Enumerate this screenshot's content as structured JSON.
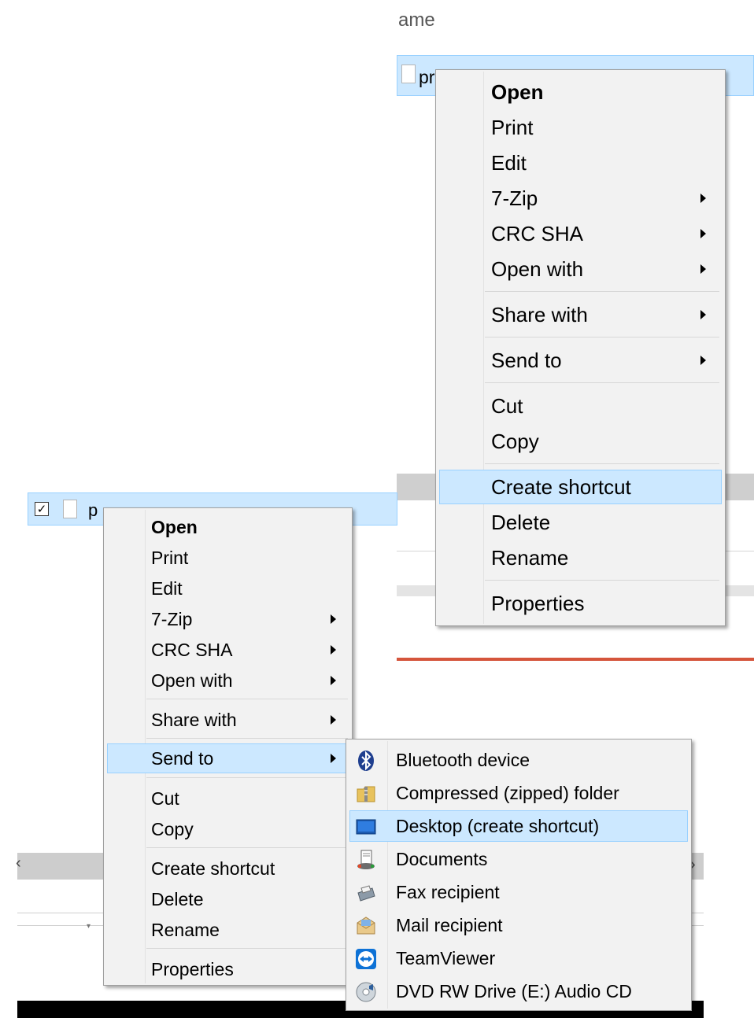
{
  "background_top": {
    "header_fragment": "ame",
    "file_name_fragment": "pr"
  },
  "background_bottom": {
    "file_name_fragment": "p",
    "checkbox_checked": true
  },
  "menu_upper": {
    "items": [
      {
        "label": "Open",
        "bold": true
      },
      {
        "label": "Print"
      },
      {
        "label": "Edit"
      },
      {
        "label": "7-Zip",
        "submenu": true
      },
      {
        "label": "CRC SHA",
        "submenu": true
      },
      {
        "label": "Open with",
        "submenu": true
      },
      {
        "label": "Share with",
        "submenu": true
      },
      {
        "label": "Send to",
        "submenu": true
      },
      {
        "label": "Cut"
      },
      {
        "label": "Copy"
      },
      {
        "label": "Create shortcut",
        "highlighted": true
      },
      {
        "label": "Delete"
      },
      {
        "label": "Rename"
      },
      {
        "label": "Properties"
      }
    ]
  },
  "menu_lower": {
    "items": [
      {
        "label": "Open",
        "bold": true
      },
      {
        "label": "Print"
      },
      {
        "label": "Edit"
      },
      {
        "label": "7-Zip",
        "submenu": true
      },
      {
        "label": "CRC SHA",
        "submenu": true
      },
      {
        "label": "Open with",
        "submenu": true
      },
      {
        "label": "Share with",
        "submenu": true
      },
      {
        "label": "Send to",
        "submenu": true,
        "highlighted": true
      },
      {
        "label": "Cut"
      },
      {
        "label": "Copy"
      },
      {
        "label": "Create shortcut"
      },
      {
        "label": "Delete"
      },
      {
        "label": "Rename"
      },
      {
        "label": "Properties"
      }
    ]
  },
  "send_to_submenu": {
    "items": [
      {
        "label": "Bluetooth device",
        "icon": "bluetooth-icon"
      },
      {
        "label": "Compressed (zipped) folder",
        "icon": "zip-folder-icon"
      },
      {
        "label": "Desktop (create shortcut)",
        "icon": "desktop-icon",
        "highlighted": true
      },
      {
        "label": "Documents",
        "icon": "documents-icon"
      },
      {
        "label": "Fax recipient",
        "icon": "fax-icon"
      },
      {
        "label": "Mail recipient",
        "icon": "mail-icon"
      },
      {
        "label": "TeamViewer",
        "icon": "teamviewer-icon"
      },
      {
        "label": "DVD RW Drive (E:) Audio CD",
        "icon": "dvd-drive-icon"
      }
    ]
  },
  "colors": {
    "selection_bg": "#cce8ff",
    "selection_border": "#99d1ff",
    "menu_bg": "#f2f2f2",
    "accent_red": "#d5553c"
  }
}
